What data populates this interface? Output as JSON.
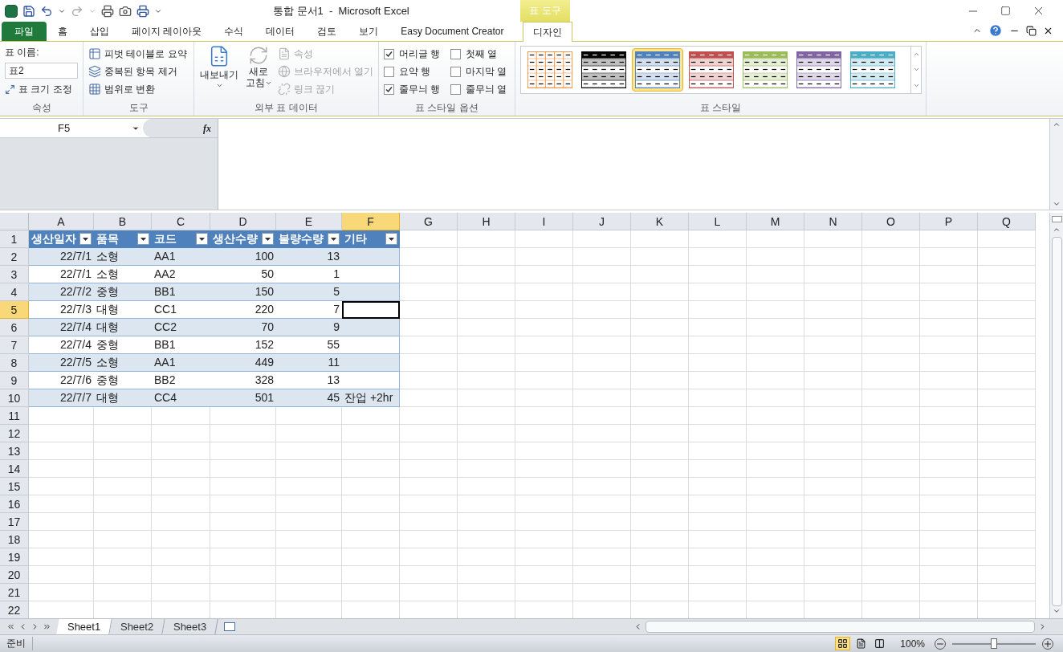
{
  "window": {
    "title": "통합 문서1  -  Microsoft Excel",
    "context_group": "표 도구"
  },
  "tabs": [
    {
      "label": "파일",
      "kind": "file",
      "selected": false
    },
    {
      "label": "홈",
      "kind": "tab",
      "selected": false
    },
    {
      "label": "삽입",
      "kind": "tab",
      "selected": false
    },
    {
      "label": "페이지 레이아웃",
      "kind": "tab",
      "selected": false
    },
    {
      "label": "수식",
      "kind": "tab",
      "selected": false
    },
    {
      "label": "데이터",
      "kind": "tab",
      "selected": false
    },
    {
      "label": "검토",
      "kind": "tab",
      "selected": false
    },
    {
      "label": "보기",
      "kind": "tab",
      "selected": false
    },
    {
      "label": "Easy Document Creator",
      "kind": "tab",
      "selected": false
    },
    {
      "label": "디자인",
      "kind": "context",
      "selected": true
    }
  ],
  "ribbon": {
    "properties": {
      "name_label": "표 이름:",
      "name_value": "표2",
      "resize": "표 크기 조정",
      "label": "속성"
    },
    "tools": {
      "items": [
        "피벗 테이블로 요약",
        "중복된 항목 제거",
        "범위로 변환"
      ],
      "label": "도구"
    },
    "external": {
      "export": "내보내기",
      "refresh_top": "새로",
      "refresh_bottom": "고침",
      "items": [
        {
          "label": "속성",
          "disabled": true
        },
        {
          "label": "브라우저에서 열기",
          "disabled": true
        },
        {
          "label": "링크 끊기",
          "disabled": true
        }
      ],
      "label": "외부 표 데이터"
    },
    "style_options": {
      "checkboxes": [
        {
          "label": "머리글 행",
          "checked": true
        },
        {
          "label": "첫째 열",
          "checked": false
        },
        {
          "label": "요약 행",
          "checked": false
        },
        {
          "label": "마지막 열",
          "checked": false
        },
        {
          "label": "줄무늬 행",
          "checked": true
        },
        {
          "label": "줄무늬 열",
          "checked": false
        }
      ],
      "label": "표 스타일 옵션"
    },
    "styles": {
      "swatches": [
        {
          "kind": "grid",
          "color": "#f79646",
          "selected": false
        },
        {
          "kind": "banded",
          "color": "#000000",
          "selected": false
        },
        {
          "kind": "banded",
          "color": "#4f81bd",
          "selected": true
        },
        {
          "kind": "banded",
          "color": "#c0504d",
          "selected": false
        },
        {
          "kind": "banded",
          "color": "#9bbb59",
          "selected": false
        },
        {
          "kind": "banded",
          "color": "#8064a2",
          "selected": false
        },
        {
          "kind": "banded",
          "color": "#4bacc6",
          "selected": false
        }
      ],
      "label": "표 스타일"
    }
  },
  "formula_bar": {
    "name_box": "F5",
    "fx": "fx"
  },
  "columns": [
    {
      "letter": "A",
      "selected": false
    },
    {
      "letter": "B",
      "selected": false
    },
    {
      "letter": "C",
      "selected": false
    },
    {
      "letter": "D",
      "selected": false
    },
    {
      "letter": "E",
      "selected": false
    },
    {
      "letter": "F",
      "selected": true
    },
    {
      "letter": "G",
      "selected": false
    },
    {
      "letter": "H",
      "selected": false
    },
    {
      "letter": "I",
      "selected": false
    },
    {
      "letter": "J",
      "selected": false
    },
    {
      "letter": "K",
      "selected": false
    },
    {
      "letter": "L",
      "selected": false
    },
    {
      "letter": "M",
      "selected": false
    },
    {
      "letter": "N",
      "selected": false
    },
    {
      "letter": "O",
      "selected": false
    },
    {
      "letter": "P",
      "selected": false
    },
    {
      "letter": "Q",
      "selected": false
    }
  ],
  "rows": [
    {
      "number": "1",
      "selected": false
    },
    {
      "number": "2",
      "selected": false
    },
    {
      "number": "3",
      "selected": false
    },
    {
      "number": "4",
      "selected": false
    },
    {
      "number": "5",
      "selected": true
    },
    {
      "number": "6",
      "selected": false
    },
    {
      "number": "7",
      "selected": false
    },
    {
      "number": "8",
      "selected": false
    },
    {
      "number": "9",
      "selected": false
    },
    {
      "number": "10",
      "selected": false
    },
    {
      "number": "11",
      "selected": false
    },
    {
      "number": "12",
      "selected": false
    },
    {
      "number": "13",
      "selected": false
    },
    {
      "number": "14",
      "selected": false
    },
    {
      "number": "15",
      "selected": false
    },
    {
      "number": "16",
      "selected": false
    },
    {
      "number": "17",
      "selected": false
    },
    {
      "number": "18",
      "selected": false
    },
    {
      "number": "19",
      "selected": false
    },
    {
      "number": "20",
      "selected": false
    },
    {
      "number": "21",
      "selected": false
    },
    {
      "number": "22",
      "selected": false
    }
  ],
  "table": {
    "columns": [
      {
        "label": "생산일자",
        "kind": "number"
      },
      {
        "label": "품목",
        "kind": "text"
      },
      {
        "label": "코드",
        "kind": "text"
      },
      {
        "label": "생산수량",
        "kind": "number"
      },
      {
        "label": "불량수량",
        "kind": "number"
      },
      {
        "label": "기타",
        "kind": "text"
      }
    ],
    "rows": [
      [
        "22/7/1",
        "소형",
        "AA1",
        "100",
        "13",
        ""
      ],
      [
        "22/7/1",
        "소형",
        "AA2",
        "50",
        "1",
        ""
      ],
      [
        "22/7/2",
        "중형",
        "BB1",
        "150",
        "5",
        ""
      ],
      [
        "22/7/3",
        "대형",
        "CC1",
        "220",
        "7",
        ""
      ],
      [
        "22/7/4",
        "대형",
        "CC2",
        "70",
        "9",
        ""
      ],
      [
        "22/7/4",
        "중형",
        "BB1",
        "152",
        "55",
        ""
      ],
      [
        "22/7/5",
        "소형",
        "AA1",
        "449",
        "11",
        ""
      ],
      [
        "22/7/6",
        "중형",
        "BB2",
        "328",
        "13",
        ""
      ],
      [
        "22/7/7",
        "대형",
        "CC4",
        "501",
        "45",
        "잔업 +2hr"
      ]
    ]
  },
  "sheets": [
    {
      "label": "Sheet1",
      "selected": true
    },
    {
      "label": "Sheet2",
      "selected": false
    },
    {
      "label": "Sheet3",
      "selected": false
    }
  ],
  "status_bar": {
    "text": "준비",
    "views": [
      {
        "kind": "normal",
        "selected": true
      },
      {
        "kind": "layout",
        "selected": false
      },
      {
        "kind": "break",
        "selected": false
      }
    ],
    "zoom": "100%",
    "zoom_slider": {
      "level": 0.5
    }
  }
}
